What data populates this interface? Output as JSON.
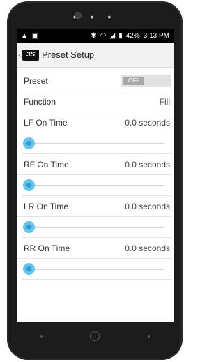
{
  "status": {
    "battery": "42%",
    "time": "3:13 PM"
  },
  "appbar": {
    "title": "Preset Setup",
    "logo_text": "3S"
  },
  "preset": {
    "label": "Preset",
    "toggle": "OFF",
    "on": false
  },
  "function": {
    "label": "Function",
    "value": "Fill"
  },
  "sliders": [
    {
      "label": "LF On Time",
      "value": "0.0 seconds",
      "level": 0
    },
    {
      "label": "RF On Time",
      "value": "0.0 seconds",
      "level": 0
    },
    {
      "label": "LR On Time",
      "value": "0.0 seconds",
      "level": 0
    },
    {
      "label": "RR On Time",
      "value": "0.0 seconds",
      "level": 0
    }
  ],
  "colors": {
    "accent": "#2f9fd0",
    "thumb": "#67c3ea",
    "appbar": "#f2f2f2",
    "statusbar": "#000000"
  },
  "icons": [
    "warning-icon",
    "image-icon",
    "bluetooth-icon",
    "wifi-icon",
    "signal-icon",
    "battery-icon",
    "back-icon"
  ]
}
